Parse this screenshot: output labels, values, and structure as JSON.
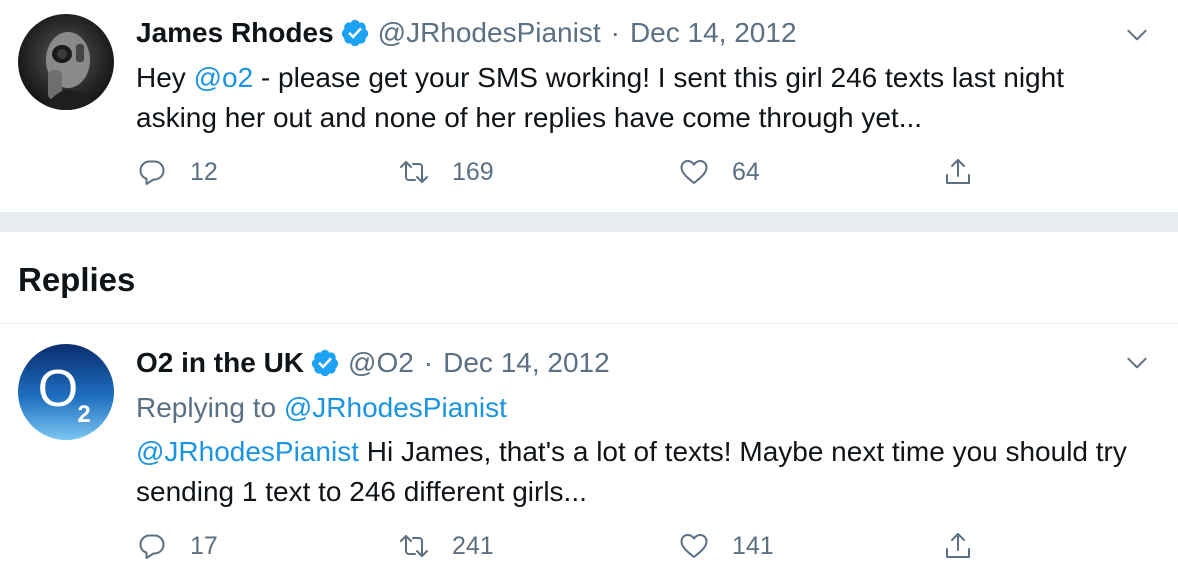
{
  "main_tweet": {
    "display_name": "James Rhodes",
    "handle": "@JRhodesPianist",
    "separator": "·",
    "date": "Dec 14, 2012",
    "text_before": "Hey ",
    "mention": "@o2",
    "text_after": " - please get your SMS working! I sent this girl 246 texts last night asking her out and none of her replies have come through yet...",
    "replies": "12",
    "retweets": "169",
    "likes": "64"
  },
  "replies_section": {
    "title": "Replies"
  },
  "reply_tweet": {
    "display_name": "O2 in the UK",
    "handle": "@O2",
    "separator": "·",
    "date": "Dec 14, 2012",
    "replying_to_label": "Replying to ",
    "replying_to_handle": "@JRhodesPianist",
    "mention": "@JRhodesPianist",
    "text_after": " Hi James, that's a lot of texts! Maybe next time you should try sending 1 text to 246 different girls...",
    "replies": "17",
    "retweets": "241",
    "likes": "141",
    "avatar_logo_letter": "O",
    "avatar_logo_sub": "2"
  },
  "colors": {
    "accent": "#1b95e0",
    "verified": "#1da1f2",
    "muted": "#5b7083",
    "separator": "#e6ecf0"
  },
  "icons": [
    "verified-badge-icon",
    "chevron-down-icon",
    "reply-icon",
    "retweet-icon",
    "like-icon",
    "share-icon"
  ]
}
